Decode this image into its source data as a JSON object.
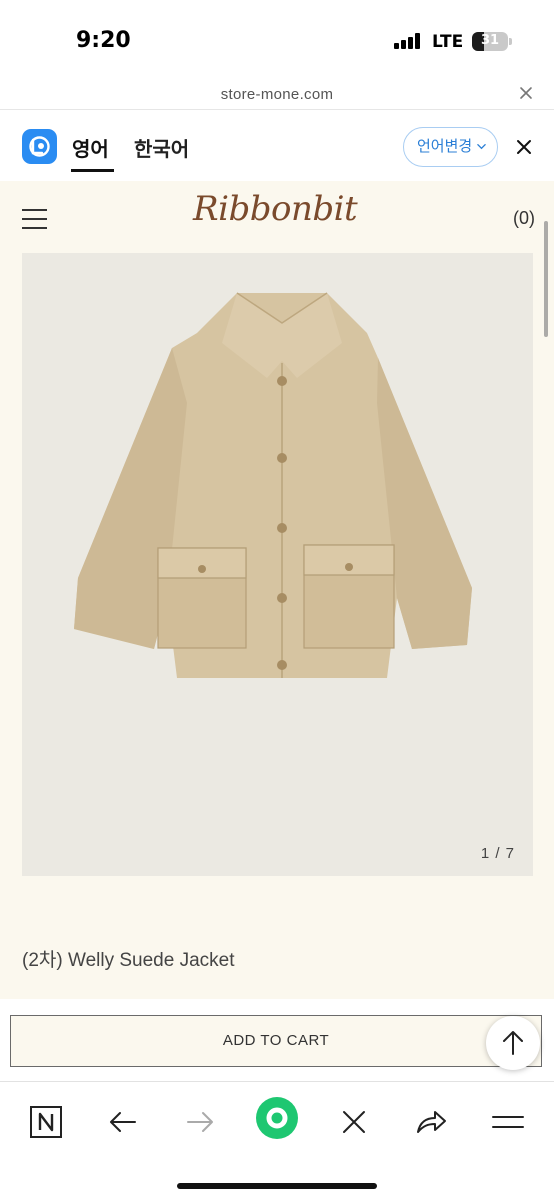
{
  "status_bar": {
    "time": "9:20",
    "network": "LTE",
    "battery": "31"
  },
  "browser": {
    "url": "store-mone.com"
  },
  "translate": {
    "tabs": [
      {
        "label": "영어",
        "active": true
      },
      {
        "label": "한국어",
        "active": false
      }
    ],
    "change_language_label": "언어변경"
  },
  "site": {
    "brand": "Ribbonbit",
    "cart_count": "(0)",
    "image_counter": "1 / 7",
    "product_title": "(2차) Welly Suede Jacket",
    "add_to_cart_label": "ADD TO CART"
  },
  "colors": {
    "page_background": "#fbf8ee",
    "brand": "#7a4a2c",
    "translate_accent": "#2a8cf2",
    "green_action": "#1ec771"
  },
  "bottom_nav": {
    "items": [
      {
        "icon": "naver-n-icon"
      },
      {
        "icon": "back-arrow-icon"
      },
      {
        "icon": "forward-arrow-icon"
      },
      {
        "icon": "green-dot-icon"
      },
      {
        "icon": "close-icon"
      },
      {
        "icon": "share-icon"
      },
      {
        "icon": "menu-icon"
      }
    ]
  }
}
